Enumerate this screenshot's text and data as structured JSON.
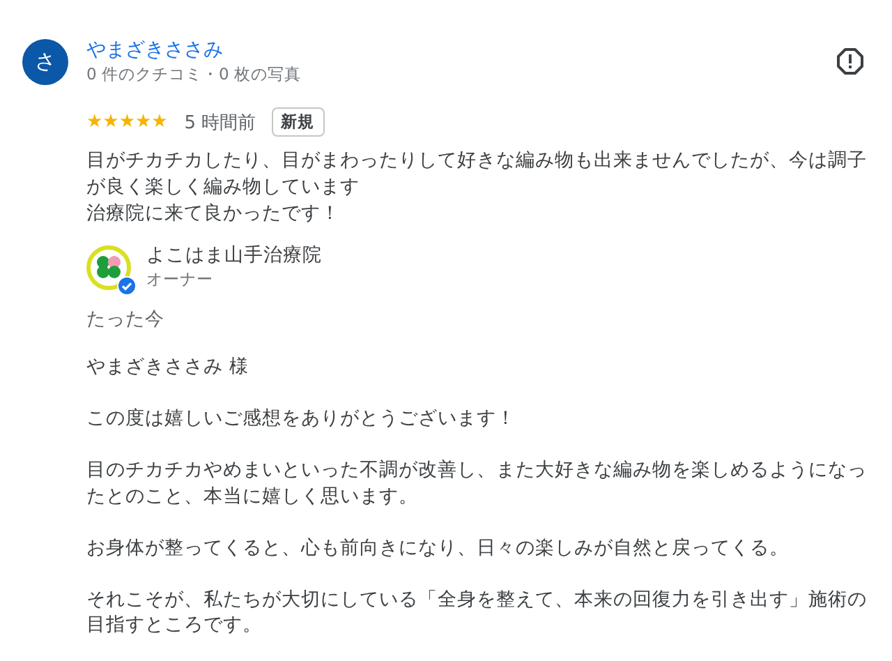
{
  "review": {
    "avatar_letter": "さ",
    "author": "やまざきささみ",
    "meta": "0 件のクチコミ・0 枚の写真",
    "stars": 5,
    "time": "5 時間前",
    "badge": "新規",
    "text_lines": [
      "目がチカチカしたり、目がまわったりして好きな編み物も出来ませんでしたが、今は調子が良く楽しく編み物しています",
      "治療院に来て良かったです！"
    ]
  },
  "reply": {
    "owner_name": "よこはま山手治療院",
    "owner_role": "オーナー",
    "verified": true,
    "time": "たった今",
    "paragraphs": [
      "やまざきささみ 様",
      "この度は嬉しいご感想をありがとうございます！",
      "目のチカチカやめまいといった不調が改善し、また大好きな編み物を楽しめるようになったとのこと、本当に嬉しく思います。",
      "お身体が整ってくると、心も前向きになり、日々の楽しみが自然と戻ってくる。",
      "それこそが、私たちが大切にしている「全身を整えて、本来の回復力を引き出す」施術の目指すところです。"
    ]
  }
}
